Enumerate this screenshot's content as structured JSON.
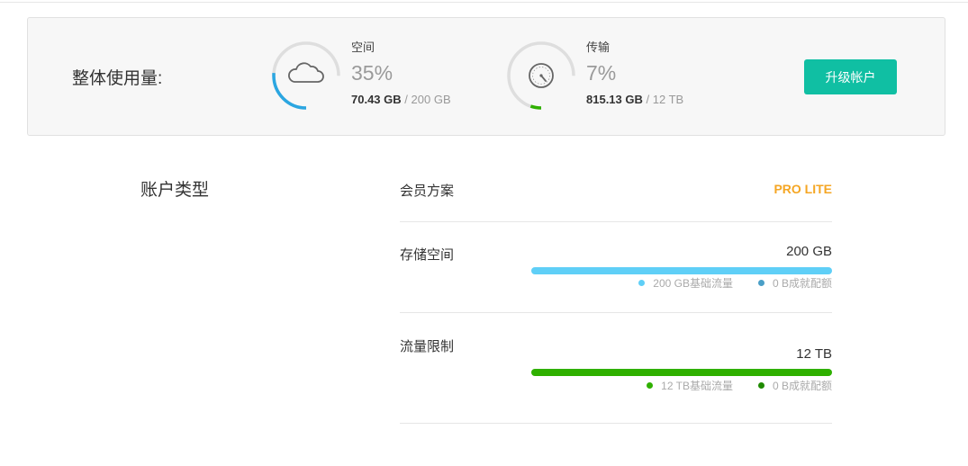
{
  "usage": {
    "title": "整体使用量:",
    "space": {
      "label": "空间",
      "percent_text": "35%",
      "percent": 35,
      "used": "70.43 GB",
      "separator": "/",
      "total": "200 GB",
      "icon": "cloud-icon",
      "arc_color": "#2ba6e1"
    },
    "transfer": {
      "label": "传输",
      "percent_text": "7%",
      "percent": 7,
      "used": "815.13 GB",
      "separator": "/",
      "total": "12 TB",
      "icon": "speedometer-icon",
      "arc_color": "#2fb000"
    },
    "upgrade_label": "升级帐户"
  },
  "account": {
    "heading": "账户类型",
    "plan": {
      "label": "会员方案",
      "value": "PRO LITE",
      "color": "#f5a623"
    },
    "storage": {
      "label": "存储空间",
      "value": "200 GB",
      "bar_color": "#5fcff7",
      "fill": 1.0,
      "legend": [
        {
          "text": "200 GB基础流量",
          "dot_color": "#5fcff7"
        },
        {
          "text": "0 B成就配额",
          "dot_color": "#4a9fc7"
        }
      ]
    },
    "transfer": {
      "label": "流量限制",
      "value": "12 TB",
      "bar_color": "#2fb000",
      "fill": 1.0,
      "legend": [
        {
          "text": "12 TB基础流量",
          "dot_color": "#2fb000"
        },
        {
          "text": "0 B成就配额",
          "dot_color": "#1f8a00"
        }
      ]
    }
  }
}
